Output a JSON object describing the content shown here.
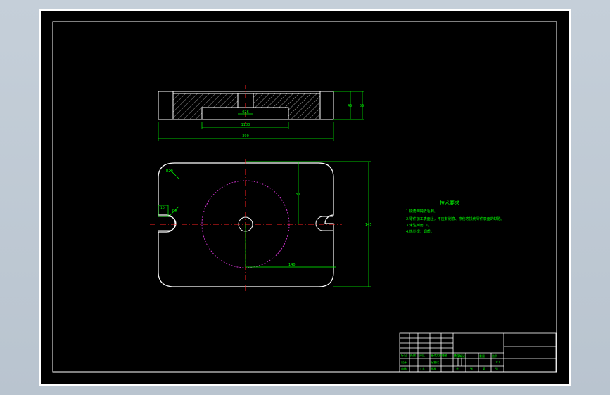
{
  "app": {
    "accent_colors": {
      "geometry": "#ffffff",
      "dimension": "#00ff00",
      "center_line": "#ff2020",
      "hidden_circle": "#cc33cc",
      "background": "#000000"
    }
  },
  "drawing": {
    "dimensions": {
      "width_total": "390",
      "inner_width": "1100",
      "slot_width": "026",
      "height_top": "45",
      "height_total": "55",
      "length_total": "145",
      "radius_corner": "R20",
      "bolt_slot": "R8",
      "center_offset": "80",
      "center_to_edge": "140",
      "slot_label": "10"
    },
    "notes": {
      "title": "技术要求",
      "lines": [
        "1.锐角倒钝去毛刺。",
        "2.零件加工表面上，不应有划痕、擦伤等损伤零件表面的缺陷。",
        "3.未注倒角C1。",
        "4.热处理：调质。"
      ]
    },
    "title_block": {
      "labels": {
        "label_1": "标记",
        "label_2": "处数",
        "label_3": "分区",
        "label_4": "更改文件号",
        "label_5": "签名",
        "label_6": "年月日",
        "label_7": "设计",
        "label_8": "标准化",
        "label_9": "阶段标记",
        "label_10": "重量",
        "label_11": "比例",
        "label_12": "审核",
        "label_13": "工艺",
        "label_14": "批准",
        "label_15": "共",
        "label_16": "张",
        "label_17": "第",
        "label_18": "张",
        "scale_value": "1:1"
      }
    }
  }
}
